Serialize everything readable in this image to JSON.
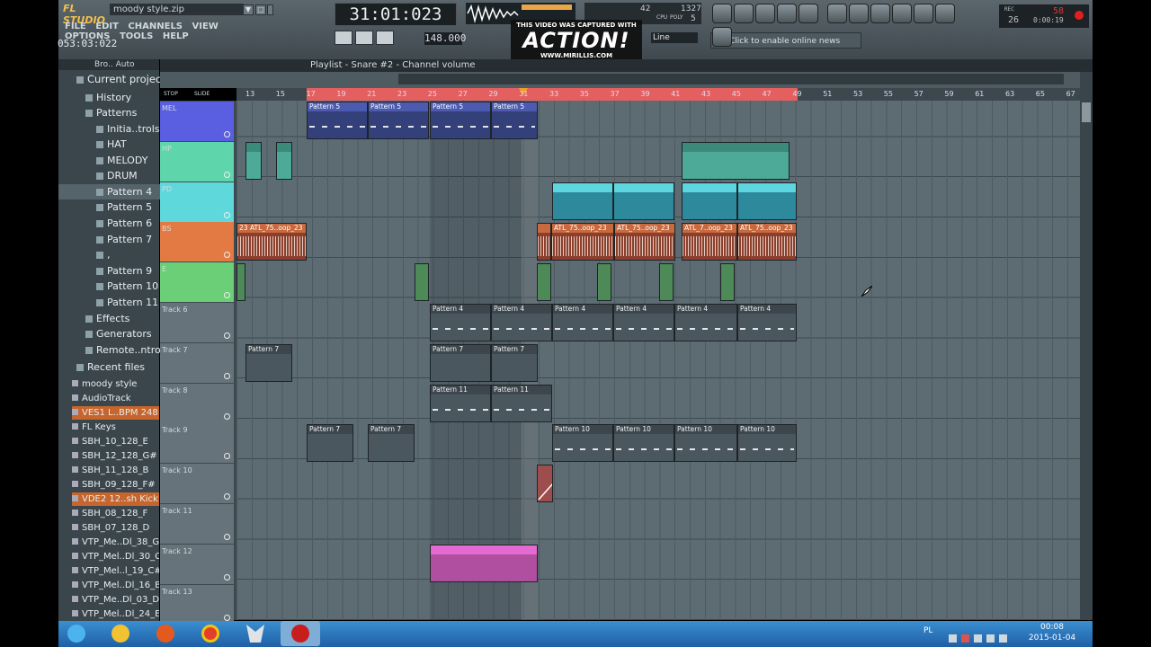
{
  "app": {
    "logo_text": "FL STUDIO",
    "title": "moody style.zip",
    "menu": [
      "FILE",
      "EDIT",
      "CHANNELS",
      "VIEW",
      "OPTIONS",
      "TOOLS",
      "HELP"
    ],
    "hint_time": "053:03:022",
    "song_position": "31:01:023",
    "tempo": "148.000",
    "snap": "Line",
    "online_news": "Click to enable online news",
    "cpu": {
      "poly_label": "POLY",
      "cpu_label": "CPU",
      "val1": "42",
      "val2": "1327",
      "val3": "5",
      "rec_label": "REC",
      "rec_val": "58",
      "mem_val": "26",
      "time": "0:00:19"
    }
  },
  "watermark": {
    "line1": "THIS VIDEO WAS CAPTURED WITH",
    "line2": "ACTION!",
    "line3": "WWW.MIRILLIS.COM"
  },
  "browser": {
    "header": "Bro.. Auto",
    "items": [
      {
        "label": "Current project"
      },
      {
        "label": "History"
      },
      {
        "label": "Patterns"
      },
      {
        "label": "Initia..trols"
      },
      {
        "label": "HAT"
      },
      {
        "label": "MELODY"
      },
      {
        "label": "DRUM"
      },
      {
        "label": "Pattern 4"
      },
      {
        "label": "Pattern 5"
      },
      {
        "label": "Pattern 6"
      },
      {
        "label": "Pattern 7"
      },
      {
        "label": ","
      },
      {
        "label": "Pattern 9"
      },
      {
        "label": "Pattern 10"
      },
      {
        "label": "Pattern 11"
      },
      {
        "label": "Effects"
      },
      {
        "label": "Generators"
      },
      {
        "label": "Remote..ntrol"
      },
      {
        "label": "Recent files"
      }
    ],
    "recent": [
      "moody style",
      "AudioTrack",
      "VES1 L..BPM 248",
      "FL Keys",
      "SBH_10_128_E",
      "SBH_12_128_G#",
      "SBH_11_128_B",
      "SBH_09_128_F#",
      "VDE2 12..sh Kick",
      "SBH_08_128_F",
      "SBH_07_128_D",
      "VTP_Me..Dl_38_G",
      "VTP_Mel..Dl_30_C",
      "VTP_Mel..l_19_C#",
      "VTP_Mel..Dl_16_B",
      "VTP_Me..Dl_03_D",
      "VTP_Mel..Dl_24_E"
    ]
  },
  "playlist": {
    "title": "Playlist - Snare #2 - Channel volume",
    "ruler": [
      "13",
      "15",
      "17",
      "19",
      "21",
      "23",
      "25",
      "27",
      "29",
      "31",
      "33",
      "35",
      "37",
      "39",
      "41",
      "43",
      "45",
      "47",
      "49",
      "51",
      "53",
      "55",
      "57",
      "59",
      "61",
      "63",
      "65",
      "67"
    ],
    "stop_label": "STOP",
    "slide_label": "SLIDE",
    "tracks": [
      "MEL",
      "HP",
      "PD",
      "BS",
      "E",
      "Track 6",
      "Track 7",
      "Track 8",
      "Track 9",
      "Track 10",
      "Track 11",
      "Track 12",
      "Track 13"
    ],
    "track_colors": [
      "#5a5ee0",
      "#5fd5ac",
      "#5fd8dc",
      "#e37a44",
      "#6bcf78",
      "#66737a",
      "#66737a",
      "#66737a",
      "#66737a",
      "#66737a",
      "#66737a",
      "#66737a",
      "#66737a"
    ],
    "clip_labels": {
      "p5": "Pattern 5",
      "p4": "Pattern 4",
      "p7": "Pattern 7",
      "p11": "Pattern 11",
      "p10": "Pattern 10",
      "atl": "ATL_75..oop_23",
      "atl2": "ATL_7..oop_23",
      "num23": "23"
    }
  },
  "taskbar": {
    "lang": "PL",
    "time": "00:08",
    "date": "2015-01-04"
  }
}
